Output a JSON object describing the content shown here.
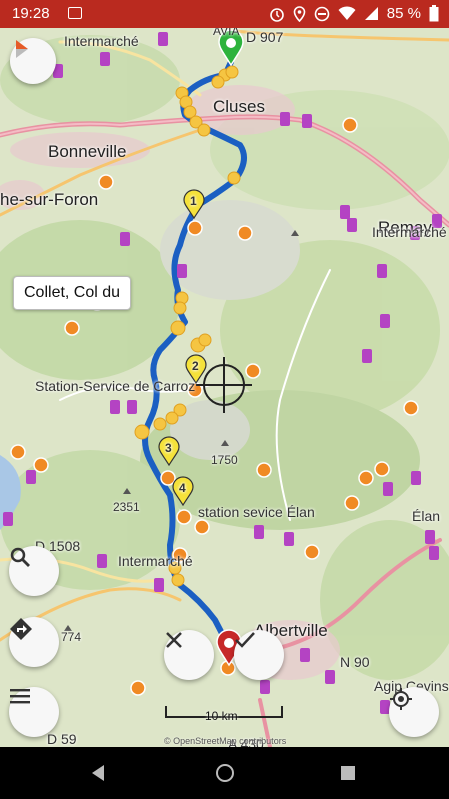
{
  "statusbar": {
    "time": "19:28",
    "battery": "85 %"
  },
  "places": {
    "intermarche_top": "Intermarché",
    "avia": "AVIA",
    "d907": "D 907",
    "cluses": "Cluses",
    "bonneville": "Bonneville",
    "roche": "he-sur-Foron",
    "remay": "Remay",
    "intermarche_right": "Intermarché",
    "carroz": "Station-Service de Carroz",
    "peak1750": "1750",
    "peak2351": "2351",
    "sevice_elan": "station sevice Élan",
    "d1508": "D 1508",
    "intermarche_bottom": "Intermarché",
    "peak774": "774",
    "albertville": "Albertville",
    "n90": "N 90",
    "agip": "Agip Cevins",
    "elan": "Élan",
    "d59": "D 59",
    "a430": "A 430"
  },
  "tooltip": {
    "label": "Collet, Col du"
  },
  "waypoints": [
    "1",
    "2",
    "3",
    "4"
  ],
  "scale": {
    "label": "10 km"
  },
  "attribution": "© OpenStreetMap contributors",
  "colors": {
    "route": "#1b5fc2",
    "marker_start": "#2db33c",
    "marker_end": "#c62828",
    "fuel": "#b443c3",
    "poi": "#f08a24"
  },
  "icons": {
    "compass": "compass-icon",
    "search": "search-icon",
    "directions": "directions-icon",
    "menu": "menu-icon",
    "close": "close-icon",
    "confirm": "check-icon",
    "locate": "my-location-icon"
  }
}
